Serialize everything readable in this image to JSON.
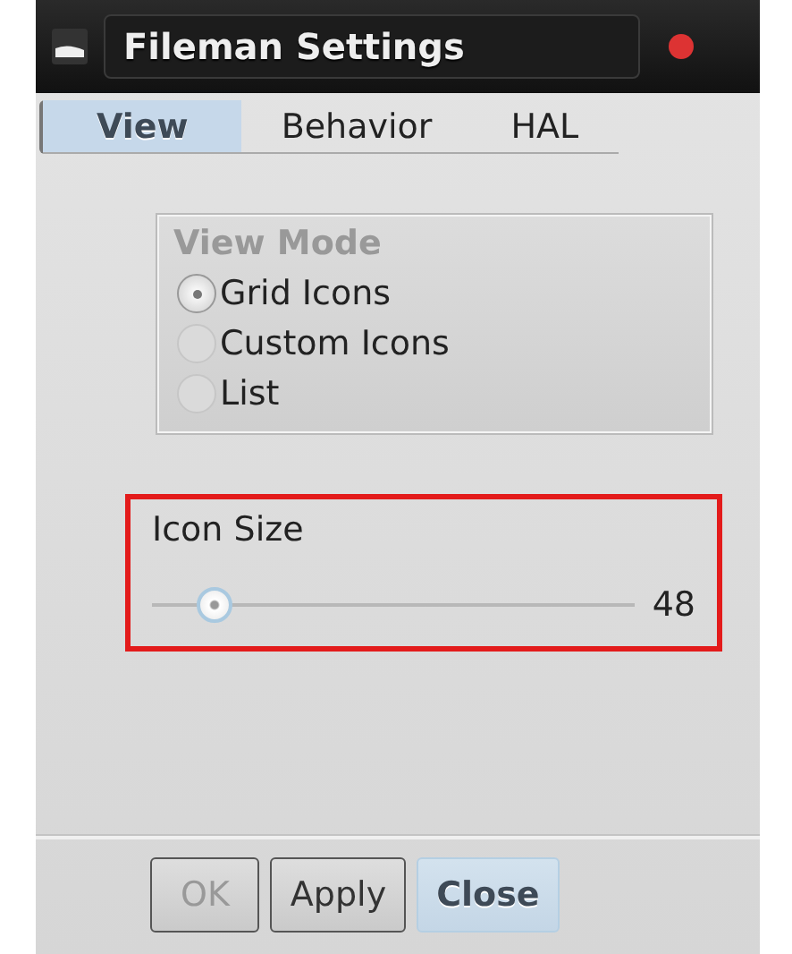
{
  "window": {
    "title": "Fileman Settings"
  },
  "tabs": [
    {
      "label": "View",
      "selected": true
    },
    {
      "label": "Behavior",
      "selected": false
    },
    {
      "label": "HAL",
      "selected": false
    }
  ],
  "view_mode": {
    "title": "View Mode",
    "options": [
      {
        "label": "Grid Icons",
        "selected": true
      },
      {
        "label": "Custom Icons",
        "selected": false
      },
      {
        "label": "List",
        "selected": false
      }
    ]
  },
  "icon_size": {
    "label": "Icon Size",
    "level": 0.13,
    "reading": "48",
    "highlighted": true
  },
  "buttons": [
    {
      "label": "OK",
      "disabled": true,
      "focused": false
    },
    {
      "label": "Apply",
      "disabled": false,
      "focused": false
    },
    {
      "label": "Close",
      "disabled": false,
      "focused": true
    }
  ]
}
